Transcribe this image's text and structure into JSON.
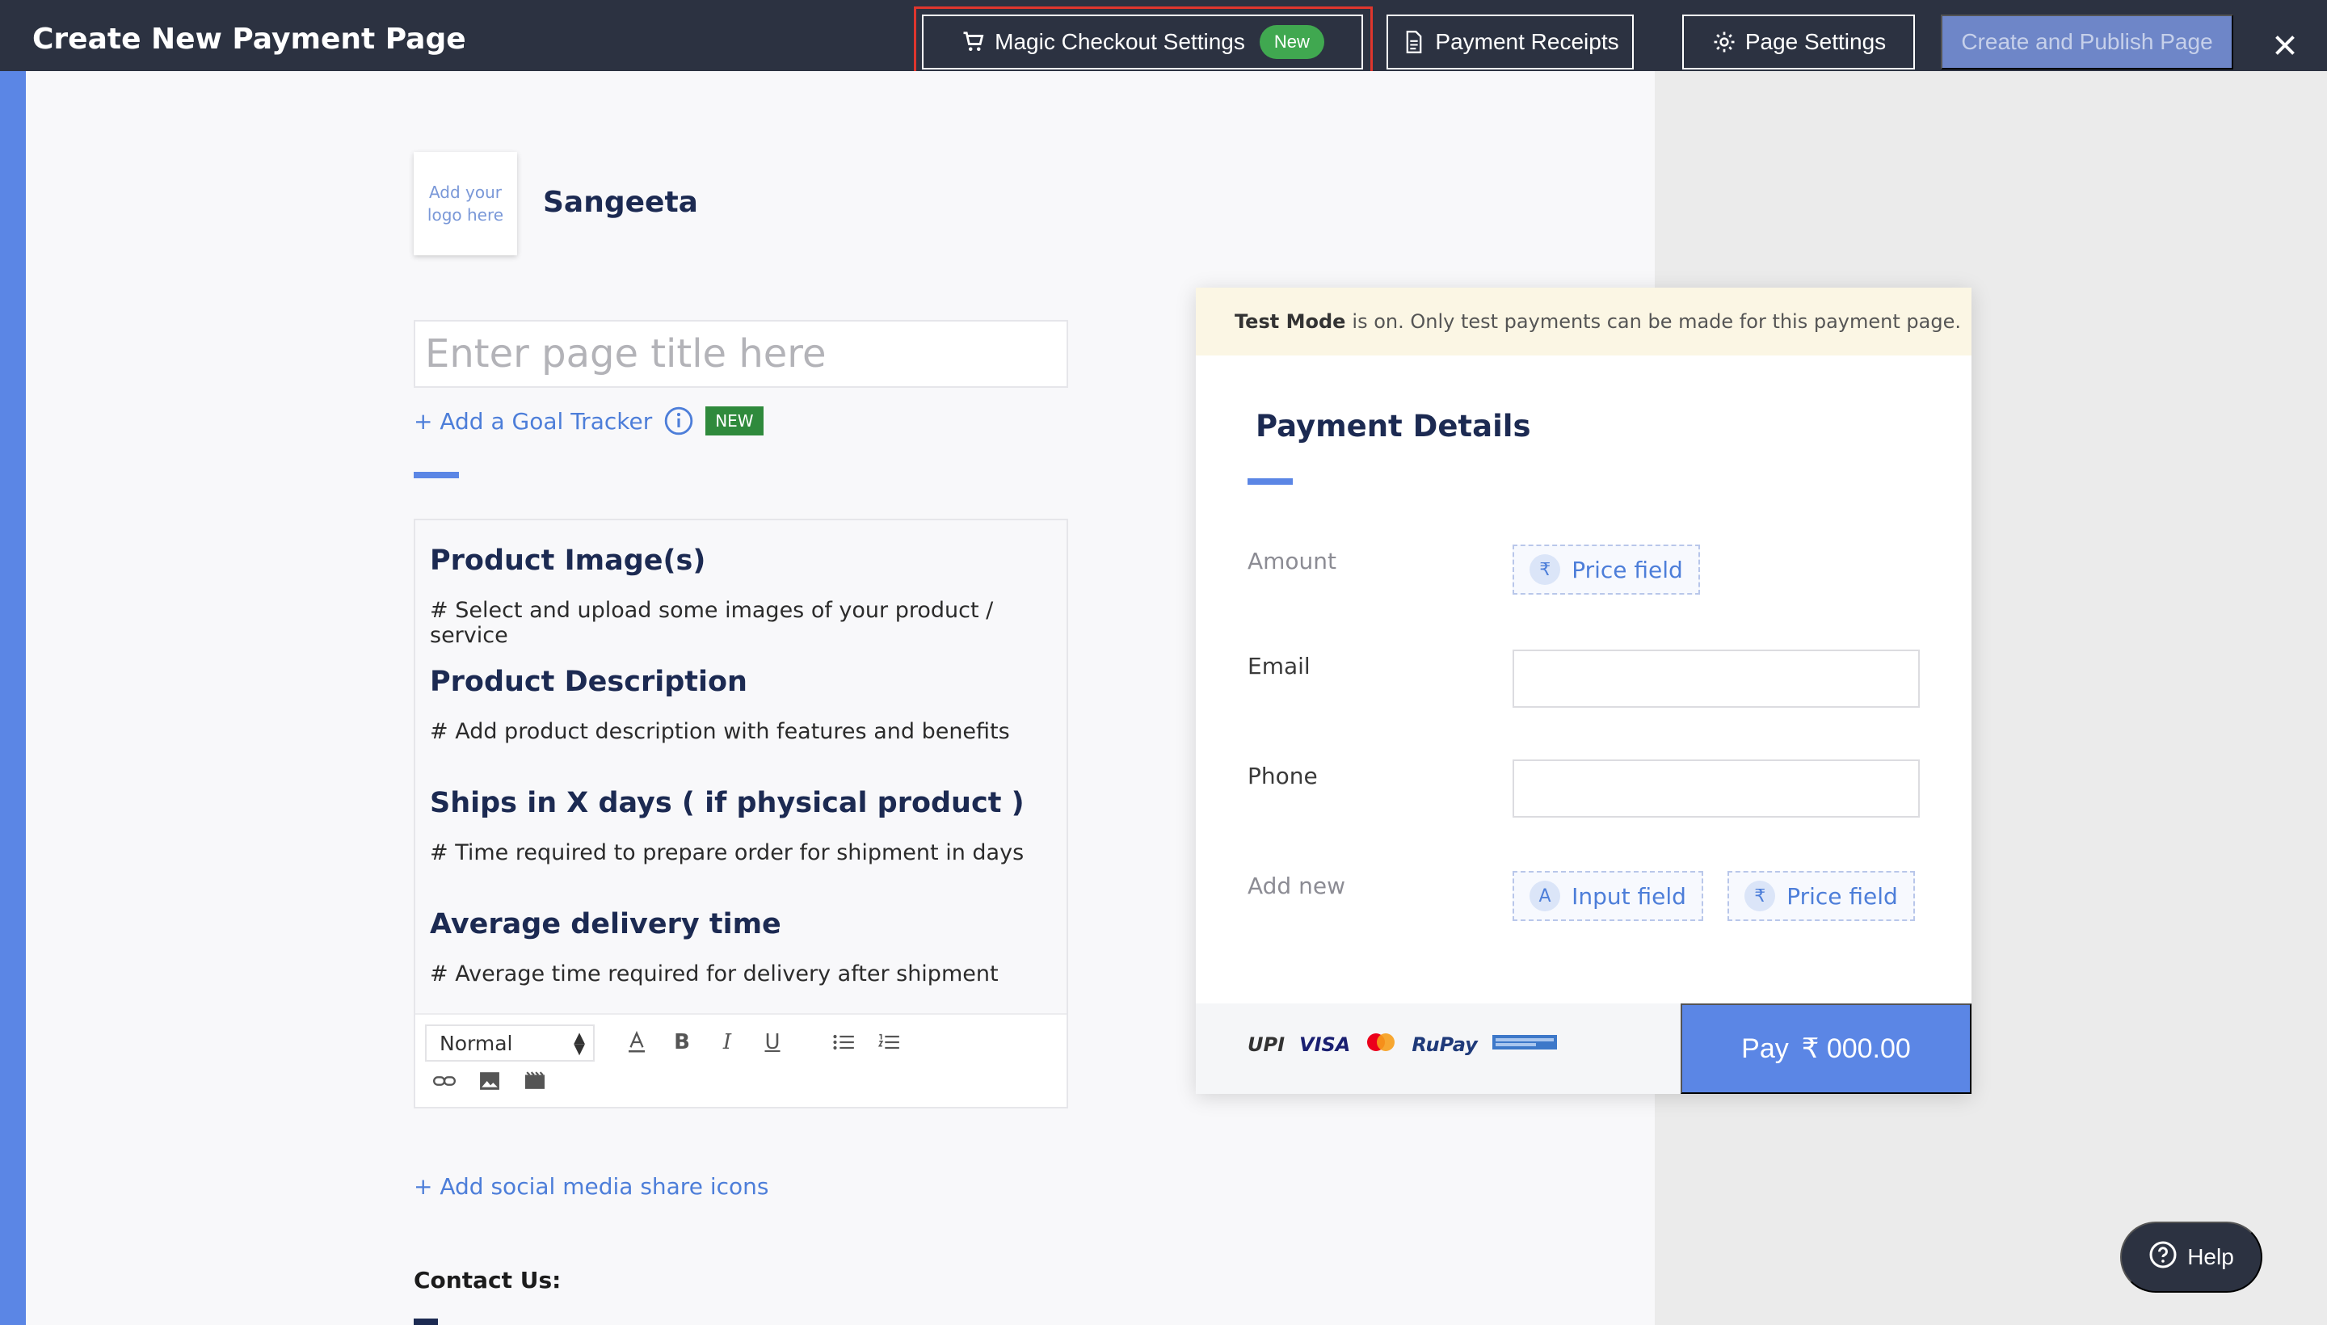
{
  "header": {
    "title": "Create New Payment Page",
    "magic_checkout_label": "Magic Checkout Settings",
    "magic_checkout_badge": "New",
    "payment_receipts_label": "Payment Receipts",
    "page_settings_label": "Page Settings",
    "publish_label": "Create and Publish Page"
  },
  "editor": {
    "logo_placeholder": "Add your logo here",
    "merchant_name": "Sangeeta",
    "title_placeholder": "Enter page title here",
    "goal_tracker_label": "+ Add a Goal Tracker",
    "goal_tracker_badge": "NEW",
    "sections": [
      {
        "title": "Product Image(s)",
        "desc": "# Select and upload some images of your product / service"
      },
      {
        "title": "Product Description",
        "desc": "# Add product description with features and benefits"
      },
      {
        "title": "Ships in X days ( if physical product )",
        "desc": "# Time required to prepare order for shipment in days"
      },
      {
        "title": "Average delivery time",
        "desc": "# Average time required for delivery after shipment"
      }
    ],
    "format_value": "Normal",
    "social_label": "+ Add social media share icons",
    "contact_label": "Contact Us:"
  },
  "payment": {
    "test_mode_bold": "Test Mode",
    "test_mode_text": "is on. Only test payments can be made for this payment page.",
    "title": "Payment Details",
    "amount_label": "Amount",
    "price_field_label": "Price field",
    "email_label": "Email",
    "phone_label": "Phone",
    "add_new_label": "Add new",
    "input_field_label": "Input field",
    "rupee_symbol": "₹",
    "input_icon_letter": "A",
    "methods": [
      "UPI",
      "VISA",
      "RuPay"
    ],
    "pay_label": "Pay",
    "pay_amount": "₹ 000.00"
  },
  "help": {
    "label": "Help"
  },
  "colors": {
    "accent": "#5b86e5",
    "header_bg": "#2c3241",
    "highlight": "#e0362d",
    "badge_green": "#40a850"
  }
}
